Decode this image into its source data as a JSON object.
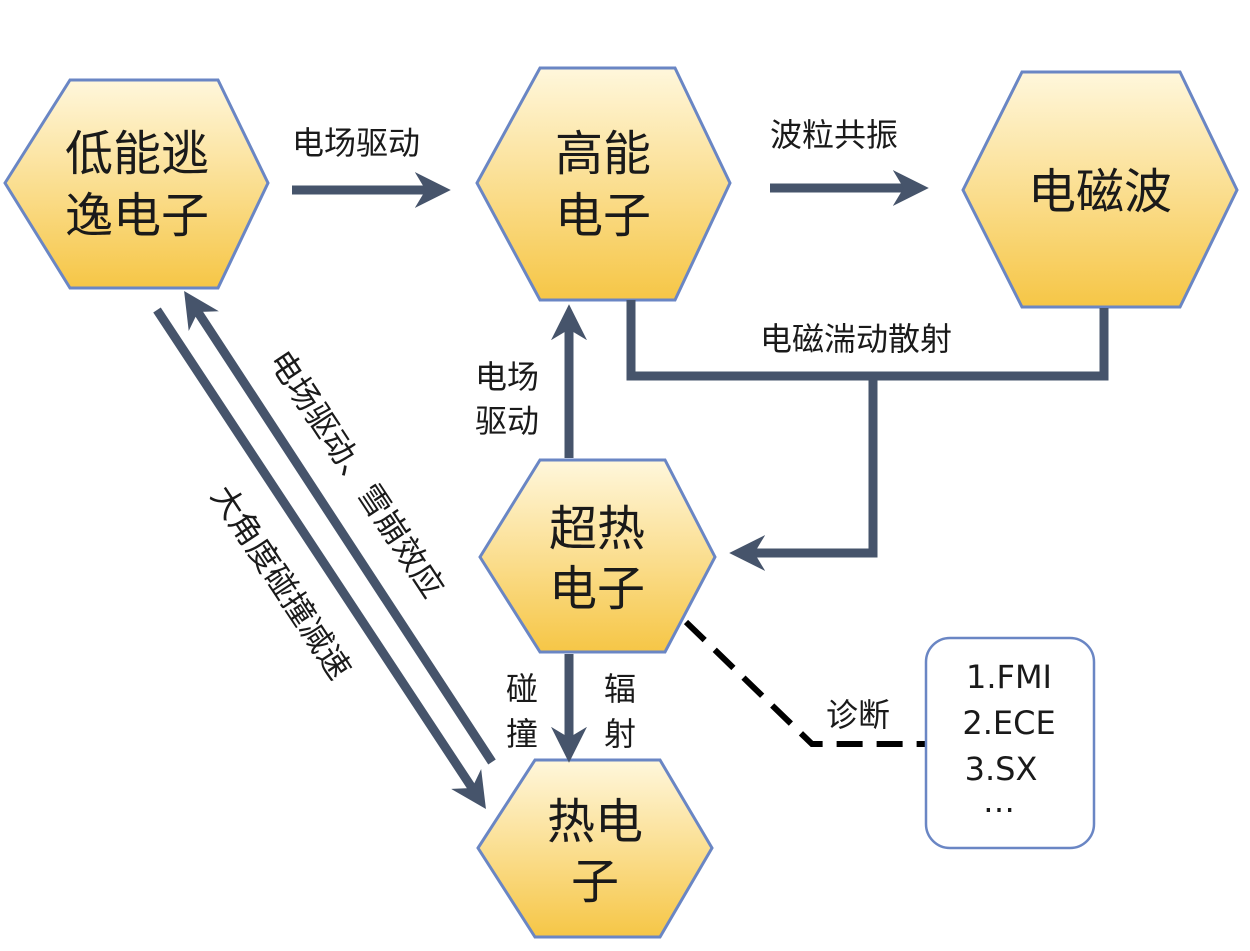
{
  "nodes": {
    "low_energy": {
      "line1": "低能逃",
      "line2": "逸电子"
    },
    "high_energy": {
      "line1": "高能",
      "line2": "电子"
    },
    "em_wave": {
      "line1": "电磁波"
    },
    "superthermal": {
      "line1": "超热",
      "line2": "电子"
    },
    "thermal": {
      "line1": "热电",
      "line2": "子"
    }
  },
  "edges": {
    "field_drive_top": "电场驱动",
    "wave_particle": "波粒共振",
    "em_scatter": "电磁湍动散射",
    "field_drive_vertical": {
      "line1": "电场",
      "line2": "驱动"
    },
    "field_drive_avalanche": "电场驱动、雪崩效应",
    "large_angle": "大角度碰撞减速",
    "collision": {
      "line1": "碰",
      "line2": "撞"
    },
    "radiation": {
      "line1": "辐",
      "line2": "射"
    },
    "diagnosis": "诊断"
  },
  "diagnostics": {
    "items": [
      "1.FMI",
      "2.ECE",
      "3.SX",
      "…"
    ]
  },
  "colors": {
    "arrow": "#46546b",
    "hex_border": "#6a86c4",
    "hex_fill_top": "#fff7dc",
    "hex_fill_bottom": "#f6c646",
    "box_border": "#6a86c4"
  }
}
